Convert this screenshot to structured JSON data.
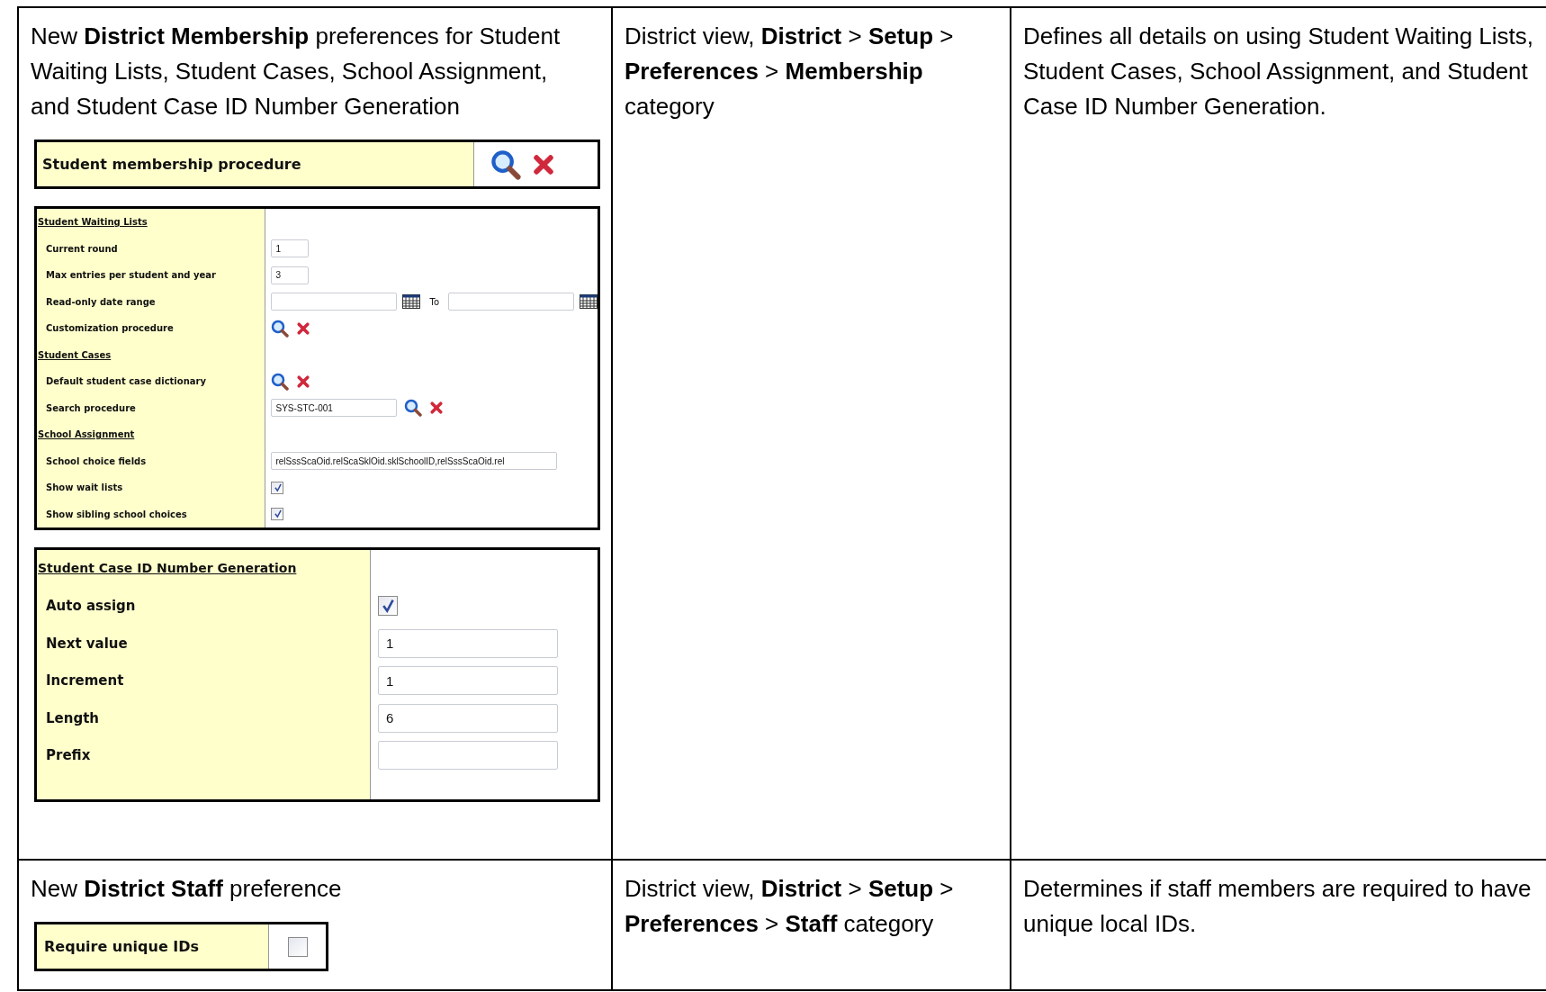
{
  "table": {
    "rows": [
      {
        "feature": {
          "intro": "New **District Membership** preferences for Student Waiting Lists, Student Cases, School Assignment, and Student Case ID Number Generation",
          "panels": [
            {
              "kind": "lookup",
              "label": "Student membership procedure"
            },
            {
              "kind": "compact_form",
              "sections": [
                {
                  "heading": "Student Waiting Lists",
                  "fields": [
                    {
                      "kind": "number",
                      "label": "Current round",
                      "value": "1"
                    },
                    {
                      "kind": "number",
                      "label": "Max entries per student and year",
                      "value": "3"
                    },
                    {
                      "kind": "daterange",
                      "label": "Read-only date range",
                      "to_label": "To"
                    },
                    {
                      "kind": "lookup",
                      "label": "Customization procedure"
                    }
                  ]
                },
                {
                  "heading": "Student Cases",
                  "fields": [
                    {
                      "kind": "lookup",
                      "label": "Default student case dictionary"
                    },
                    {
                      "kind": "text_lookup",
                      "label": "Search procedure",
                      "value": "SYS-STC-001"
                    }
                  ]
                },
                {
                  "heading": "School Assignment",
                  "fields": [
                    {
                      "kind": "text",
                      "label": "School choice fields",
                      "value": "relSssScaOid.relScaSklOid.sklSchoolID,relSssScaOid.rel"
                    },
                    {
                      "kind": "checkbox",
                      "label": "Show wait lists",
                      "checked": true
                    },
                    {
                      "kind": "checkbox",
                      "label": "Show sibling school choices",
                      "checked": true
                    }
                  ]
                }
              ]
            },
            {
              "kind": "form",
              "sections": [
                {
                  "heading": "Student Case ID Number Generation",
                  "fields": [
                    {
                      "kind": "checkbox",
                      "label": "Auto assign",
                      "checked": true
                    },
                    {
                      "kind": "text",
                      "label": "Next value",
                      "value": "1"
                    },
                    {
                      "kind": "text",
                      "label": "Increment",
                      "value": "1"
                    },
                    {
                      "kind": "text",
                      "label": "Length",
                      "value": "6"
                    },
                    {
                      "kind": "text",
                      "label": "Prefix"
                    }
                  ]
                }
              ]
            }
          ]
        },
        "location": "District view, **District** > **Setup** > **Preferences** > **Membership** category",
        "description": "Defines all details on using Student Waiting Lists, Student Cases, School Assignment, and Student Case ID Number Generation."
      },
      {
        "feature": {
          "intro": "New **District Staff** preference",
          "panels": [
            {
              "kind": "checkbox",
              "label": "Require unique IDs",
              "checked": false
            }
          ]
        },
        "location": "District view, **District** > **Setup** > **Preferences** > **Staff** category",
        "description": "Determines if staff members are required to have unique local IDs."
      }
    ]
  }
}
